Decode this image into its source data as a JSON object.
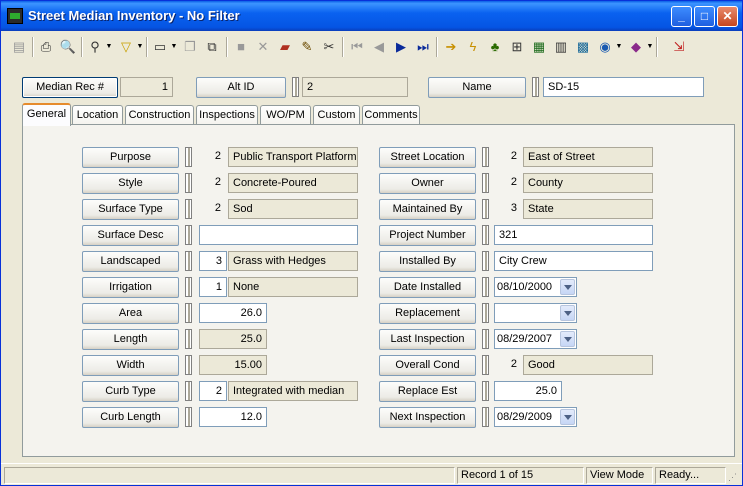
{
  "window": {
    "title": "Street Median Inventory - No Filter"
  },
  "toolbar": {
    "icons": [
      "record-icon",
      "print-icon",
      "print-preview-icon",
      "binoculars-icon",
      "filter-icon",
      "new-record-icon",
      "copy-icon",
      "duplicate-icon",
      "save-icon",
      "delete-icon",
      "books-icon",
      "pencil-icon",
      "scissors-icon",
      "first-record-icon",
      "previous-record-icon",
      "next-record-icon",
      "last-record-icon",
      "arrow-right-icon",
      "lightning-icon",
      "tree-icon",
      "hierarchy-icon",
      "map-icon",
      "calculator-icon",
      "grid-map-icon",
      "globe-icon",
      "book-icon",
      "exit-icon"
    ]
  },
  "header": {
    "median_rec_label": "Median Rec #",
    "median_rec_value": "1",
    "alt_id_label": "Alt ID",
    "alt_id_value": "2",
    "name_label": "Name",
    "name_value": "SD-15"
  },
  "tabs": [
    "General",
    "Location",
    "Construction",
    "Inspections",
    "WO/PM",
    "Custom",
    "Comments"
  ],
  "left_fields": [
    {
      "label": "Purpose",
      "code": "2",
      "value": "Public Transport Platform"
    },
    {
      "label": "Style",
      "code": "2",
      "value": "Concrete-Poured"
    },
    {
      "label": "Surface Type",
      "code": "2",
      "value": "Sod"
    },
    {
      "label": "Surface Desc",
      "code": "",
      "value": ""
    },
    {
      "label": "Landscaped",
      "code": "3",
      "value": "Grass with Hedges"
    },
    {
      "label": "Irrigation",
      "code": "1",
      "value": "None"
    },
    {
      "label": "Area",
      "code": "",
      "value": "26.0"
    },
    {
      "label": "Length",
      "code": "",
      "value": "25.0"
    },
    {
      "label": "Width",
      "code": "",
      "value": "15.00"
    },
    {
      "label": "Curb Type",
      "code": "2",
      "value": "Integrated with median"
    },
    {
      "label": "Curb Length",
      "code": "",
      "value": "12.0"
    }
  ],
  "right_fields": [
    {
      "label": "Street Location",
      "code": "2",
      "value": "East of Street"
    },
    {
      "label": "Owner",
      "code": "2",
      "value": "County"
    },
    {
      "label": "Maintained By",
      "code": "3",
      "value": "State"
    },
    {
      "label": "Project Number",
      "code": "",
      "value": "321"
    },
    {
      "label": "Installed By",
      "code": "",
      "value": "City Crew"
    },
    {
      "label": "Date Installed",
      "code": "",
      "value": "08/10/2000"
    },
    {
      "label": "Replacement",
      "code": "",
      "value": " /  /"
    },
    {
      "label": "Last Inspection",
      "code": "",
      "value": "08/29/2007"
    },
    {
      "label": "Overall Cond",
      "code": "2",
      "value": "Good"
    },
    {
      "label": "Replace Est",
      "code": "",
      "value": "25.0"
    },
    {
      "label": "Next Inspection",
      "code": "",
      "value": "08/29/2009"
    }
  ],
  "status": {
    "record": "Record 1 of 15",
    "mode": "View Mode",
    "state": "Ready..."
  }
}
